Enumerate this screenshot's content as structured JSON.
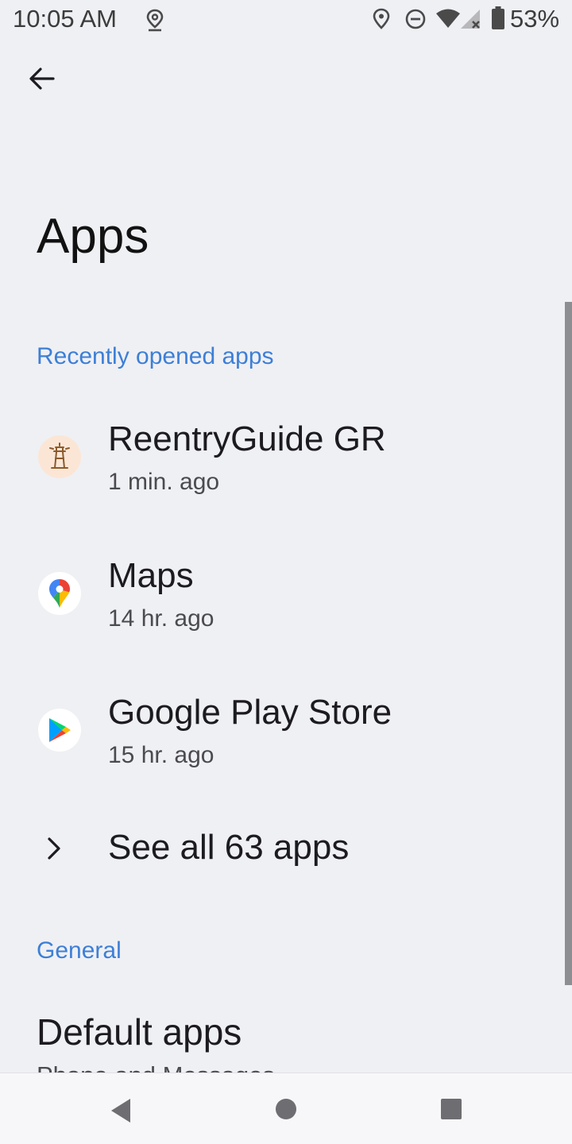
{
  "status_bar": {
    "time": "10:05 AM",
    "battery": "53%",
    "icons": [
      "location-outline-icon",
      "location-icon",
      "do-not-disturb-icon",
      "wifi-icon",
      "signal-no-service-icon",
      "battery-icon"
    ]
  },
  "header": {
    "back_icon": "back-arrow-icon",
    "title": "Apps"
  },
  "recent": {
    "section_label": "Recently opened apps",
    "apps": [
      {
        "name": "ReentryGuide GR",
        "time": "1 min. ago",
        "icon": "lighthouse-icon"
      },
      {
        "name": "Maps",
        "time": "14 hr. ago",
        "icon": "google-maps-icon"
      },
      {
        "name": "Google Play Store",
        "time": "15 hr. ago",
        "icon": "google-play-icon"
      }
    ],
    "see_all_label": "See all 63 apps"
  },
  "general": {
    "section_label": "General",
    "default_apps": {
      "title": "Default apps",
      "subtitle": "Phone and Messages"
    }
  },
  "nav": {
    "back": "nav-back-icon",
    "home": "nav-home-icon",
    "recents": "nav-recents-icon"
  },
  "colors": {
    "background": "#eff0f4",
    "accent": "#3d7fd6",
    "text_primary": "#1c1b1f",
    "text_secondary": "#4a4a4f"
  }
}
